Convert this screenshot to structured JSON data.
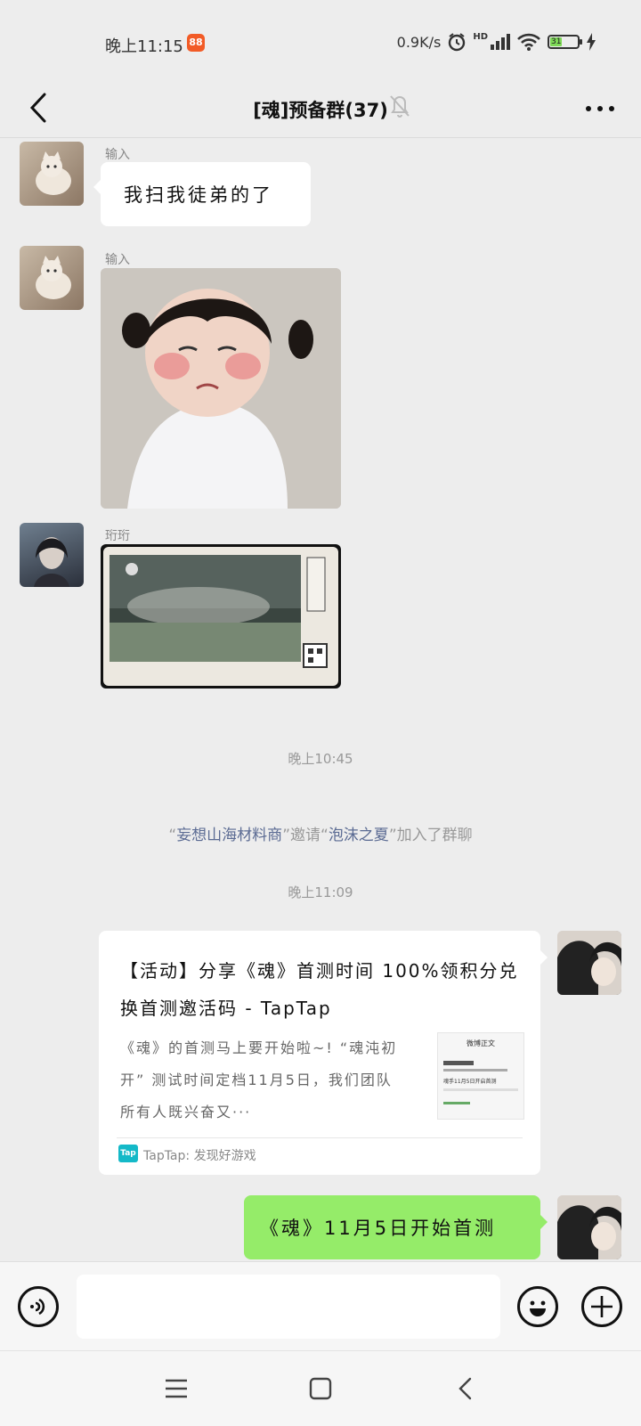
{
  "status": {
    "time": "晚上11:15",
    "app_badge": "88",
    "net_speed": "0.9K/s",
    "hd": "HD",
    "battery_level": "31",
    "battery_color": "#7ed957"
  },
  "header": {
    "title": "[魂]预备群(37)",
    "back_icon": "chevron-left-icon",
    "mute_icon": "bell-off-icon",
    "more_icon": "more-dots-icon"
  },
  "messages": {
    "m1": {
      "sender": "输入",
      "text": "我扫我徒弟的了"
    },
    "m2": {
      "sender": "输入",
      "image": "crying-girl-sticker"
    },
    "m3": {
      "sender": "珩珩",
      "image": "game-screenshot-card"
    },
    "time1": "晚上10:45",
    "system": {
      "inviter": "妄想山海材料商",
      "verb": "邀请",
      "invitee": "泡沫之夏",
      "suffix": "加入了群聊"
    },
    "time2": "晚上11:09",
    "card": {
      "title": "【活动】分享《魂》首测时间 100%领积分兑换首测邀活码 - TapTap",
      "desc": "《魂》的首测马上要开始啦~! “魂沌初开” 测试时间定档11月5日，我们团队所有人既兴奋又···",
      "thumb_title": "微博正文",
      "thumb_line": "魂手11月5日开启首测",
      "source_logo": "Tap",
      "source": "TapTap: 发现好游戏"
    },
    "m5": {
      "text": "《魂》11月5日开始首测"
    }
  },
  "input": {
    "voice_icon": "voice-icon",
    "emoji_icon": "emoji-icon",
    "plus_icon": "plus-icon",
    "placeholder": ""
  },
  "sysnav": {
    "menu_icon": "menu-icon",
    "home_icon": "home-icon",
    "back_icon": "back-icon"
  }
}
